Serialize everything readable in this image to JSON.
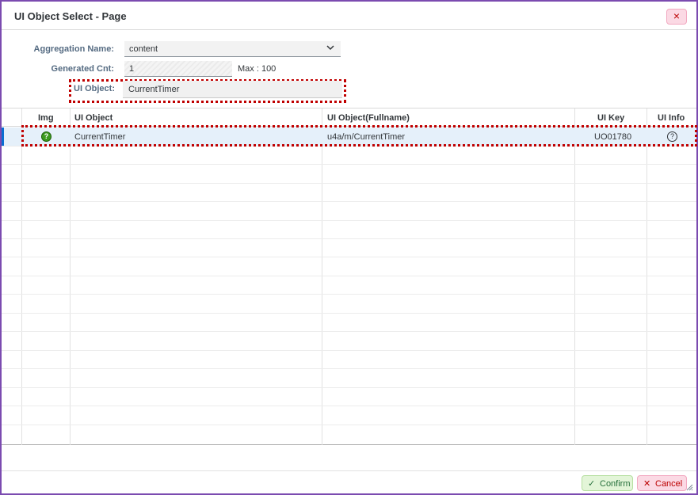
{
  "dialog": {
    "title": "UI Object Select - Page",
    "close_icon": "close-icon",
    "close_label": "×"
  },
  "form": {
    "aggregation_label": "Aggregation Name:",
    "aggregation_value": "content",
    "generated_label": "Generated Cnt:",
    "generated_value": "1",
    "max_text": "Max : 100",
    "ui_object_label": "UI Object:",
    "ui_object_value": "CurrentTimer"
  },
  "table": {
    "columns": [
      "Img",
      "UI Object",
      "UI Object(Fullname)",
      "UI Key",
      "UI Info"
    ],
    "rows": [
      {
        "img_icon": "question-circle-icon",
        "img_glyph": "?",
        "ui_object": "CurrentTimer",
        "fullname": "u4a/m/CurrentTimer",
        "ui_key": "UO01780",
        "info_icon": "help-icon",
        "info_glyph": "?"
      }
    ]
  },
  "footer": {
    "confirm_label": "Confirm",
    "confirm_icon": "✓",
    "cancel_label": "Cancel",
    "cancel_icon": "✕"
  },
  "colors": {
    "border": "#7b4bb0",
    "highlight": "#c00000",
    "selected_row": "#e5f0fa",
    "confirm_bg": "#e3f5d8",
    "cancel_bg": "#fbd9e4"
  }
}
